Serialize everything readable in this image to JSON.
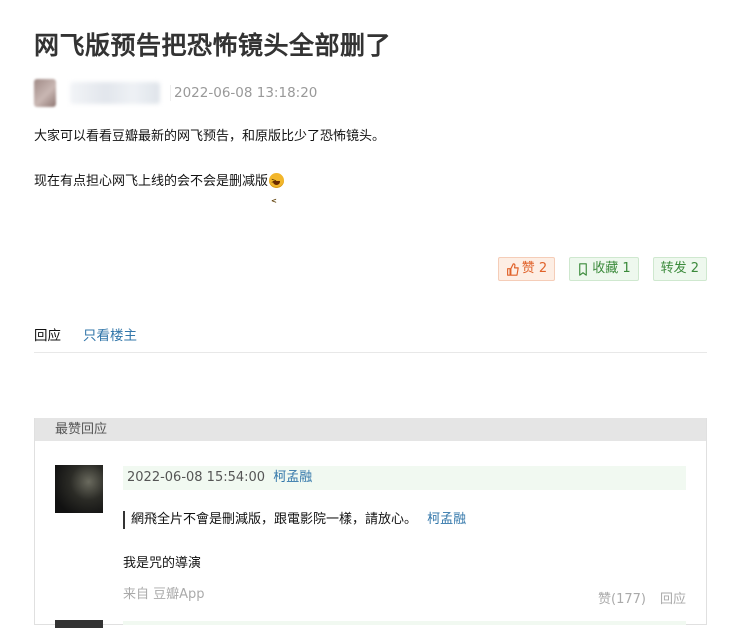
{
  "post": {
    "title": "网飞版预告把恐怖镜头全部删了",
    "date": "2022-06-08 13:18:20",
    "paragraphs": [
      "大家可以看看豆瓣最新的网飞预告，和原版比少了恐怖镜头。",
      "现在有点担心网飞上线的会不会是删减版"
    ],
    "emoji_icon": "dizzy-face-emoji"
  },
  "actions": {
    "like_label": "赞 2",
    "fav_label": "收藏 1",
    "share_label": "转发 2",
    "like_icon": "thumbs-up-icon",
    "fav_icon": "bookmark-icon"
  },
  "tabs": {
    "reply": "回应",
    "op_only": "只看楼主"
  },
  "top_replies": {
    "header": "最赞回应",
    "comment": {
      "date": "2022-06-08 15:54:00",
      "user": "柯孟融",
      "quote_text": "網飛全片不會是刪減版，跟電影院一樣，請放心。",
      "quote_author": "柯孟融",
      "text": "我是咒的導演",
      "source": "来自 豆瓣App",
      "likes": "赞(177)",
      "reply": "回应"
    }
  },
  "colors": {
    "link": "#3377aa",
    "like": "#e0622a",
    "green": "#3b8a3b"
  }
}
